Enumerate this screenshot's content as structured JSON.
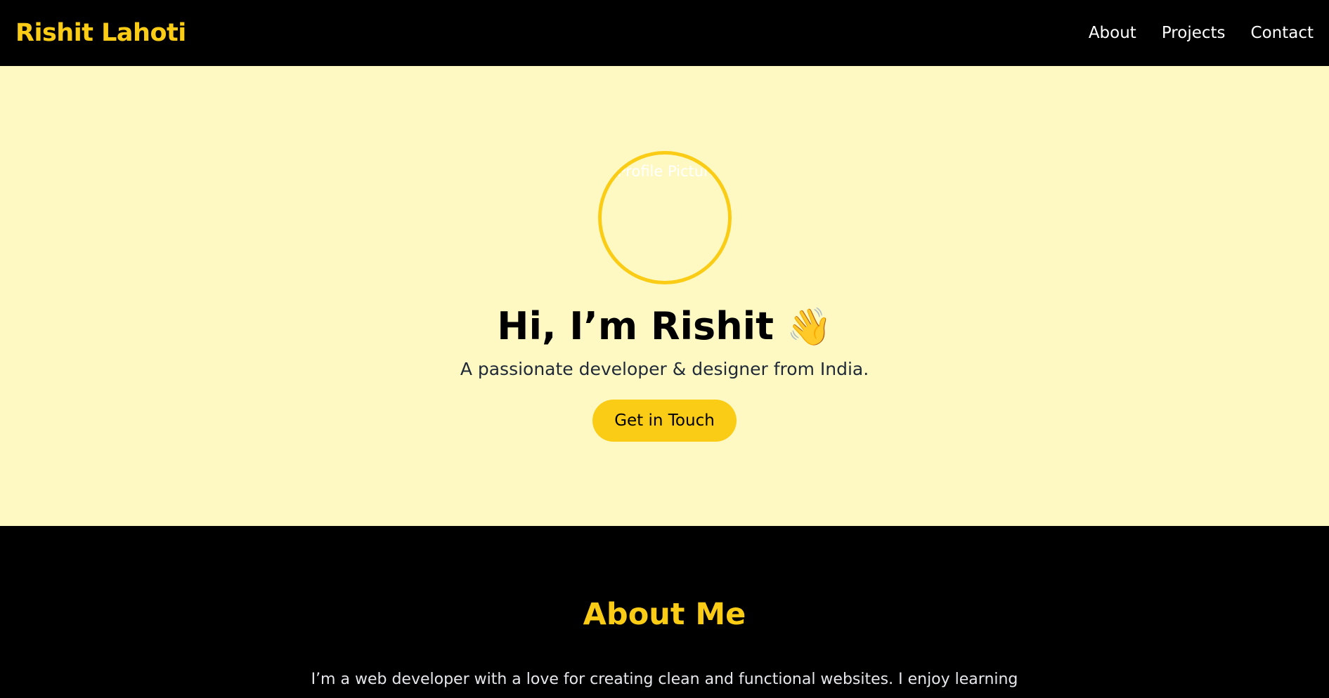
{
  "navbar": {
    "brand": "Rishit Lahoti",
    "links": [
      "About",
      "Projects",
      "Contact"
    ]
  },
  "hero": {
    "avatar_alt": "Profile Picture",
    "title": "Hi, I’m Rishit",
    "wave_icon": "👋",
    "subtitle": "A passionate developer & designer from India.",
    "cta_label": "Get in Touch"
  },
  "about": {
    "title": "About Me",
    "text": "I’m a web developer with a love for creating clean and functional websites. I enjoy learning new technologies and building projects that make a real-world impact."
  },
  "colors": {
    "accent": "#facc15",
    "hero_bg": "#fef9c3",
    "dark_bg": "#000000"
  }
}
